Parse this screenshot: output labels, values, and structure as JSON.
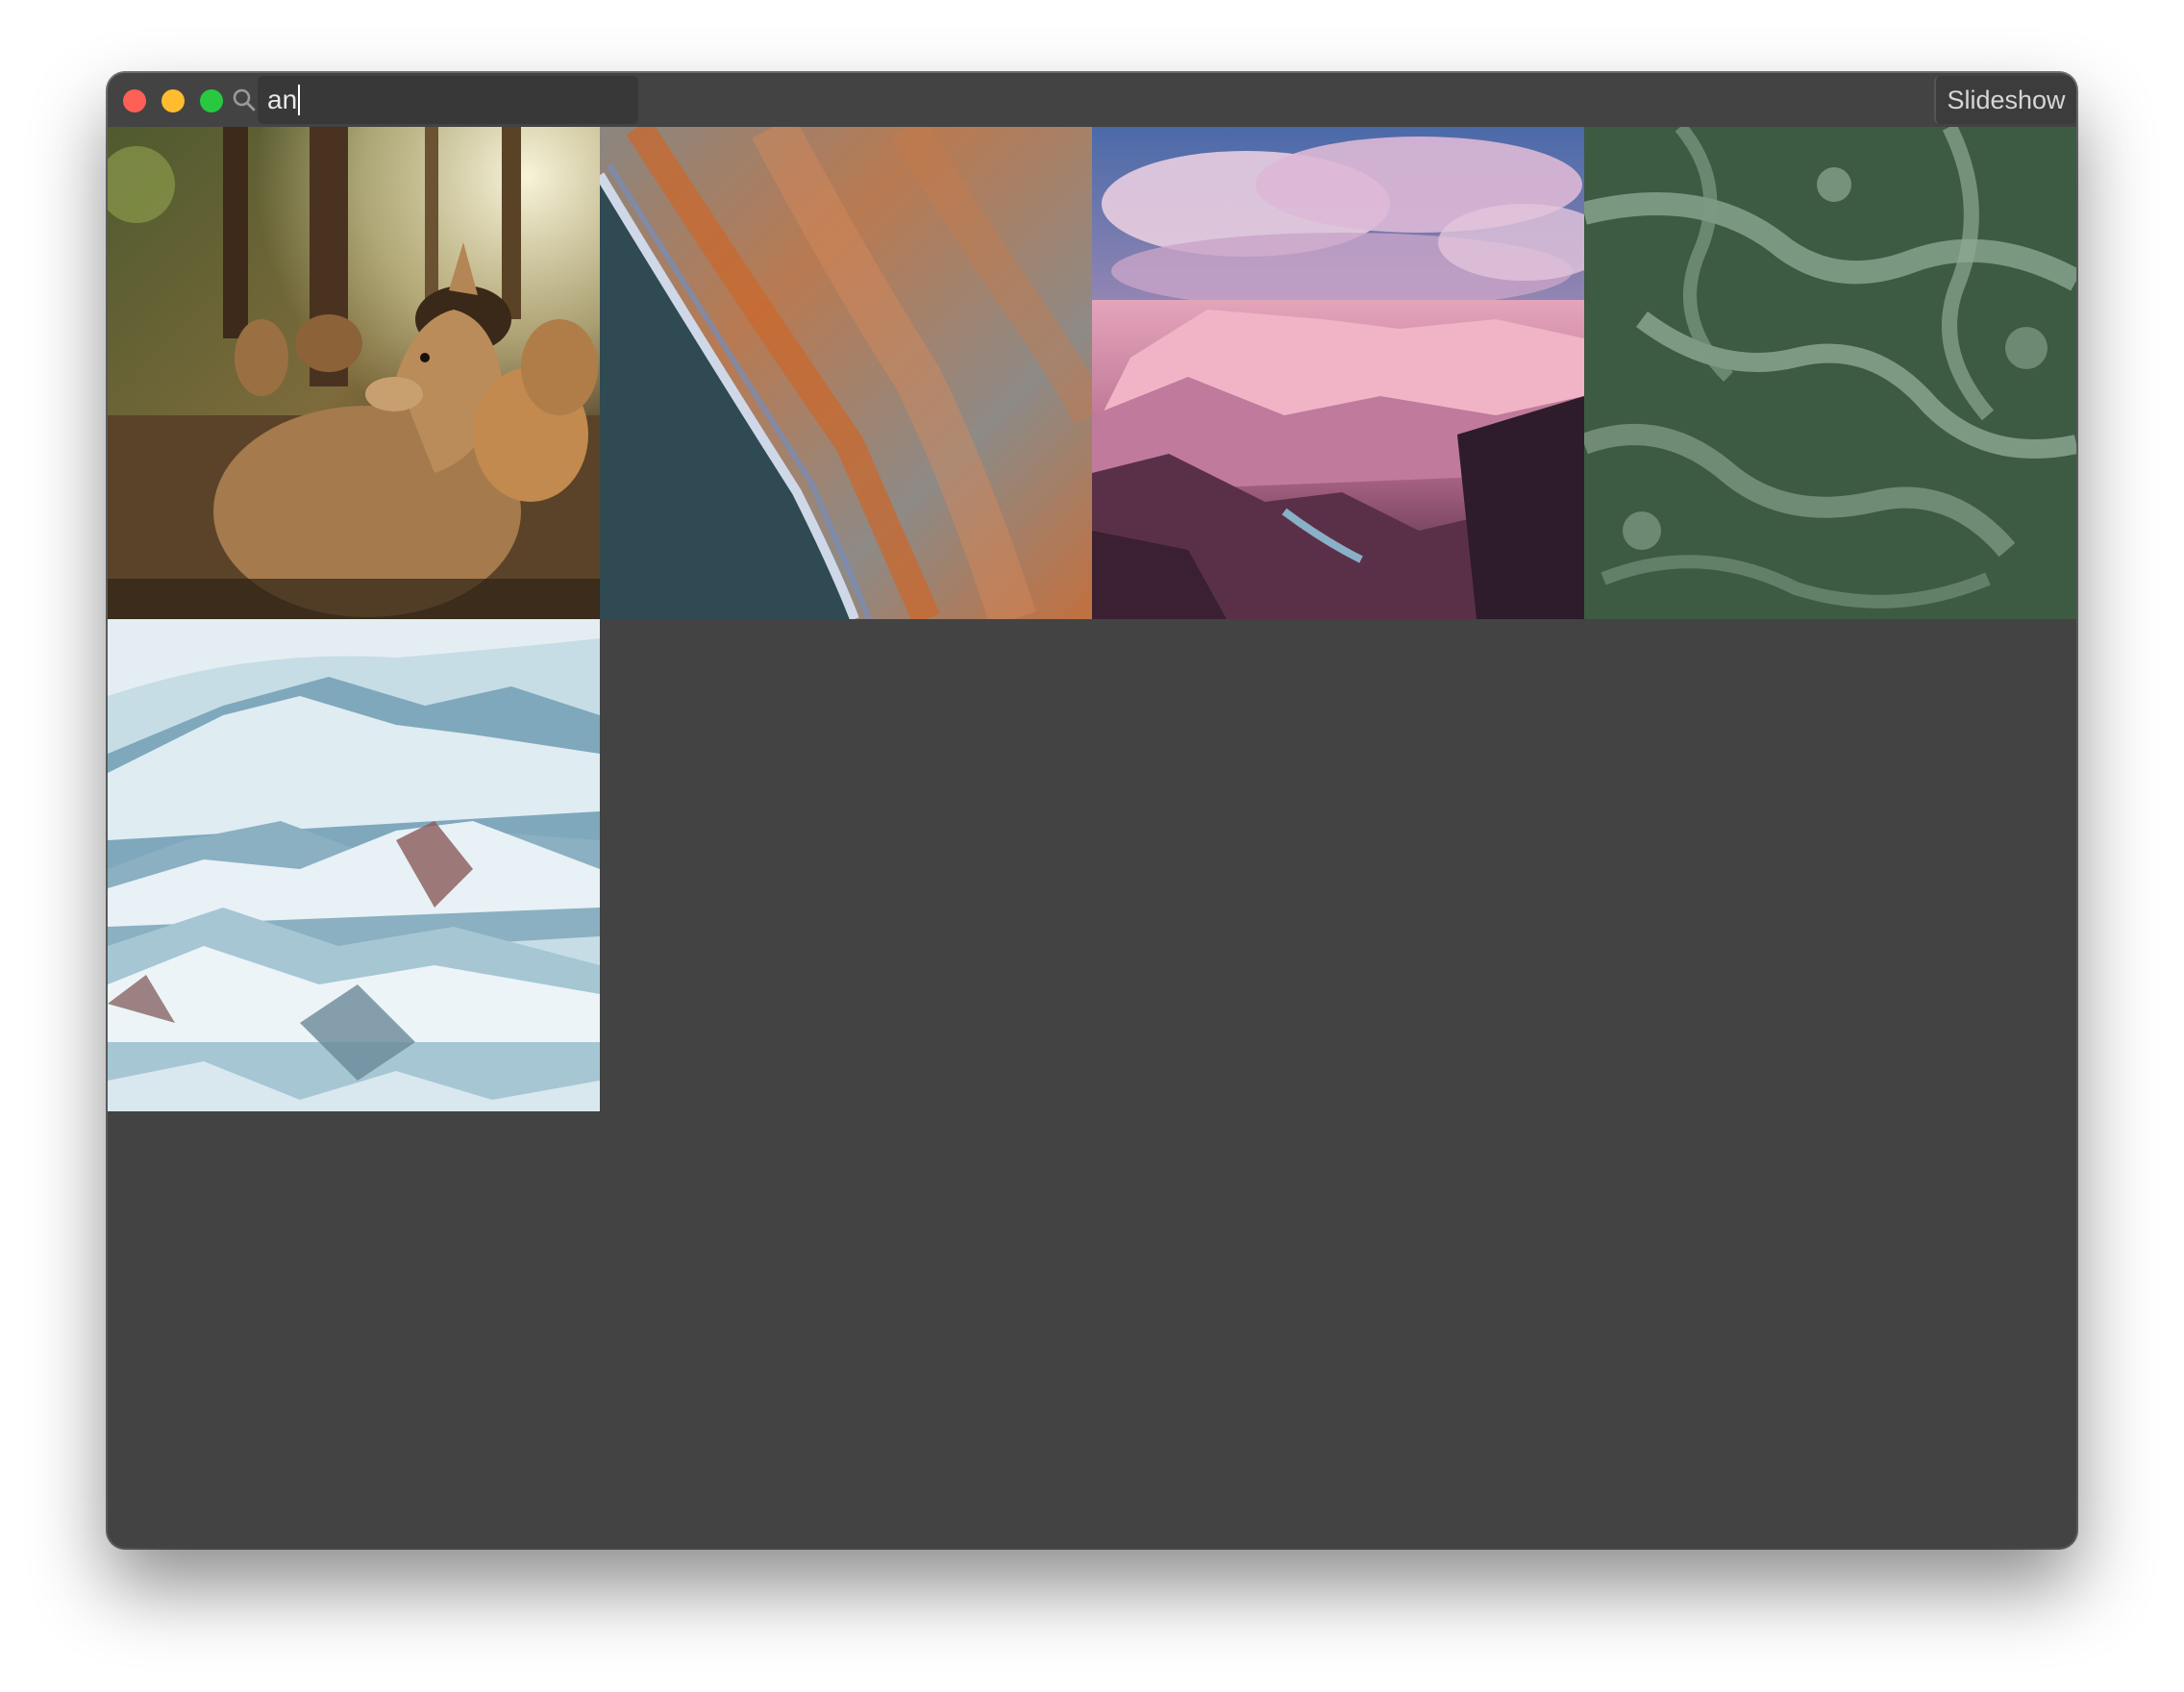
{
  "window": {
    "traffic_lights": {
      "close_color": "#fe5f57",
      "minimize_color": "#febc2e",
      "maximize_color": "#28c840"
    }
  },
  "toolbar": {
    "search_icon": "magnifier-icon",
    "search_value": "an",
    "slideshow_label": "Slideshow"
  },
  "gallery": {
    "background": "#434343",
    "images": [
      {
        "subject": "deer-photo"
      },
      {
        "subject": "aerial-coastline-photo"
      },
      {
        "subject": "canyon-painting"
      },
      {
        "subject": "sea-foam-photo"
      },
      {
        "subject": "snowy-mountains-photo"
      }
    ]
  }
}
